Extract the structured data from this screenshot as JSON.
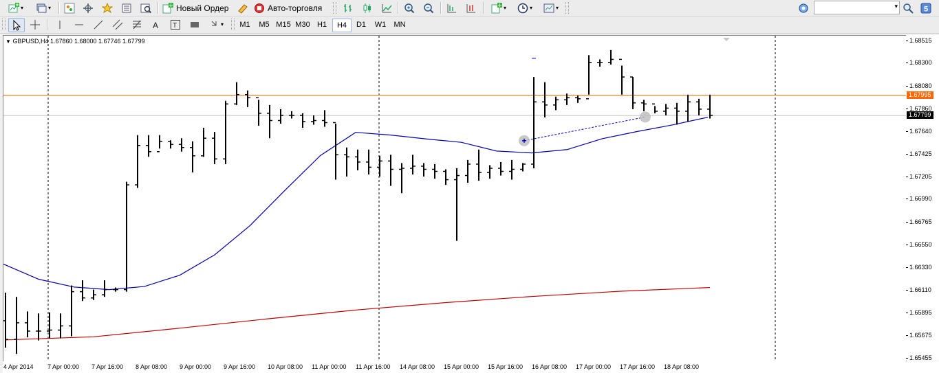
{
  "toolbar": {
    "new_order_label": "Новый Ордер",
    "autotrading_label": "Авто-торговля",
    "search_value": "",
    "icons": [
      "new-chart-icon",
      "profiles-icon",
      "market-watch-icon",
      "navigator-icon",
      "favorites-icon",
      "data-window-icon",
      "strategy-tester-icon",
      "new-order-icon",
      "autotrading-icon",
      "bar-chart-icon",
      "candlestick-icon",
      "line-chart-icon",
      "zoom-in-icon",
      "zoom-out-icon",
      "tile-icon",
      "autoscroll-icon",
      "indicators-icon",
      "periods-icon",
      "templates-icon",
      "options-icon",
      "search-icon",
      "help-icon"
    ]
  },
  "drawing_tools": [
    "cursor-icon",
    "crosshair-icon",
    "vertical-line-icon",
    "horizontal-line-icon",
    "trendline-icon",
    "equidistant-channel-icon",
    "fibonacci-icon",
    "text-icon",
    "text-label-icon",
    "rectangle-icon",
    "arrows-icon"
  ],
  "timeframes": [
    "M1",
    "M5",
    "M15",
    "M30",
    "H1",
    "H4",
    "D1",
    "W1",
    "MN"
  ],
  "active_timeframe": "H4",
  "chart": {
    "symbol_info": "GBPUSD,H4  1.67860 1.68000 1.67746 1.67799",
    "colors": {
      "bars": "#000000",
      "ma_fast": "#0000aa",
      "ma_slow": "#c00000",
      "price_line": "#ff6600",
      "bid_line": "#c0c0c0",
      "current_price_bg": "#000000",
      "marker_price_bg": "#ff6600"
    }
  },
  "chart_data": {
    "type": "ohlc",
    "symbol": "GBPUSD",
    "timeframe": "H4",
    "y_ticks": [
      "1.68515",
      "1.68300",
      "1.68080",
      "1.67860",
      "1.67640",
      "1.67425",
      "1.67205",
      "1.66990",
      "1.66765",
      "1.66550",
      "1.66330",
      "1.66110",
      "1.65895",
      "1.65675",
      "1.65455"
    ],
    "ylim": [
      1.65455,
      1.68515
    ],
    "x_labels": [
      "4 Apr 2014",
      "7 Apr 00:00",
      "7 Apr 16:00",
      "8 Apr 08:00",
      "9 Apr 00:00",
      "9 Apr 16:00",
      "10 Apr 08:00",
      "11 Apr 00:00",
      "11 Apr 16:00",
      "14 Apr 08:00",
      "15 Apr 00:00",
      "15 Apr 16:00",
      "16 Apr 08:00",
      "17 Apr 00:00",
      "17 Apr 16:00",
      "18 Apr 08:00"
    ],
    "current_price": "1.67799",
    "marked_price": "1.67995",
    "bars": [
      [
        1.6582,
        1.6609,
        1.6556,
        1.6564
      ],
      [
        1.6564,
        1.6605,
        1.655,
        1.658
      ],
      [
        1.658,
        1.6591,
        1.6566,
        1.6572
      ],
      [
        1.6572,
        1.6589,
        1.6563,
        1.6572
      ],
      [
        1.6572,
        1.659,
        1.6565,
        1.6573
      ],
      [
        1.6573,
        1.6589,
        1.6565,
        1.6577
      ],
      [
        1.6577,
        1.6616,
        1.6567,
        1.661
      ],
      [
        1.661,
        1.6621,
        1.6601,
        1.6604
      ],
      [
        1.6604,
        1.6612,
        1.6602,
        1.6607
      ],
      [
        1.6607,
        1.6621,
        1.6605,
        1.6612
      ],
      [
        1.6612,
        1.6614,
        1.661,
        1.6612
      ],
      [
        1.6612,
        1.6716,
        1.661,
        1.6713
      ],
      [
        1.6713,
        1.6761,
        1.671,
        1.6751
      ],
      [
        1.6751,
        1.6761,
        1.674,
        1.6745
      ],
      [
        1.6745,
        1.6761,
        1.6748,
        1.6755
      ],
      [
        1.6755,
        1.6756,
        1.6748,
        1.6752
      ],
      [
        1.6752,
        1.6758,
        1.6745,
        1.6749
      ],
      [
        1.6749,
        1.6755,
        1.6725,
        1.6741
      ],
      [
        1.6741,
        1.6768,
        1.674,
        1.6758
      ],
      [
        1.6758,
        1.6764,
        1.6733,
        1.6738
      ],
      [
        1.6738,
        1.6794,
        1.6733,
        1.6791
      ],
      [
        1.6791,
        1.6812,
        1.679,
        1.68
      ],
      [
        1.68,
        1.6804,
        1.6788,
        1.6797
      ],
      [
        1.6797,
        1.6795,
        1.677,
        1.6782
      ],
      [
        1.6782,
        1.679,
        1.6758,
        1.6775
      ],
      [
        1.6775,
        1.6786,
        1.6772,
        1.678
      ],
      [
        1.678,
        1.6784,
        1.6777,
        1.678
      ],
      [
        1.678,
        1.6782,
        1.6768,
        1.6774
      ],
      [
        1.6774,
        1.678,
        1.6771,
        1.6775
      ],
      [
        1.6775,
        1.6785,
        1.6769,
        1.6773
      ],
      [
        1.6773,
        1.6772,
        1.6718,
        1.6742
      ],
      [
        1.6742,
        1.6749,
        1.6721,
        1.674
      ],
      [
        1.674,
        1.6747,
        1.6727,
        1.6735
      ],
      [
        1.6735,
        1.6747,
        1.6723,
        1.673
      ],
      [
        1.673,
        1.6741,
        1.6721,
        1.6736
      ],
      [
        1.6736,
        1.6742,
        1.6712,
        1.6728
      ],
      [
        1.6728,
        1.6734,
        1.6705,
        1.6729
      ],
      [
        1.6729,
        1.6742,
        1.6723,
        1.6731
      ],
      [
        1.6731,
        1.6734,
        1.6721,
        1.6728
      ],
      [
        1.6728,
        1.6733,
        1.6719,
        1.6726
      ],
      [
        1.6726,
        1.6728,
        1.6713,
        1.6718
      ],
      [
        1.6718,
        1.6729,
        1.6659,
        1.6722
      ],
      [
        1.6722,
        1.6737,
        1.6715,
        1.6733
      ],
      [
        1.6733,
        1.6747,
        1.6717,
        1.6725
      ],
      [
        1.6725,
        1.6732,
        1.6719,
        1.6729
      ],
      [
        1.6729,
        1.6735,
        1.6722,
        1.6726
      ],
      [
        1.6726,
        1.6737,
        1.6718,
        1.6728
      ],
      [
        1.6728,
        1.6734,
        1.6726,
        1.6733
      ],
      [
        1.6733,
        1.6817,
        1.6729,
        1.6793
      ],
      [
        1.6793,
        1.6812,
        1.6778,
        1.679
      ],
      [
        1.679,
        1.6798,
        1.6785,
        1.6795
      ],
      [
        1.6795,
        1.6801,
        1.679,
        1.6797
      ],
      [
        1.6797,
        1.6799,
        1.6792,
        1.6796
      ],
      [
        1.6796,
        1.6838,
        1.68,
        1.6831
      ],
      [
        1.6831,
        1.6834,
        1.6827,
        1.6831
      ],
      [
        1.6831,
        1.6843,
        1.6829,
        1.6834
      ],
      [
        1.6834,
        1.6828,
        1.68,
        1.6817
      ],
      [
        1.6817,
        1.6817,
        1.6786,
        1.6792
      ],
      [
        1.6792,
        1.6795,
        1.6784,
        1.6791
      ],
      [
        1.6791,
        1.6789,
        1.6782,
        1.6784
      ],
      [
        1.6784,
        1.6791,
        1.678,
        1.6787
      ],
      [
        1.6787,
        1.6792,
        1.6771,
        1.6784
      ],
      [
        1.6784,
        1.68,
        1.6774,
        1.6793
      ],
      [
        1.6793,
        1.6796,
        1.678,
        1.6786
      ],
      [
        1.6786,
        1.68,
        1.6777,
        1.678
      ]
    ],
    "ma_fast": [
      1.66366,
      1.6622,
      1.66145,
      1.6612,
      1.6615,
      1.66258,
      1.66456,
      1.66737,
      1.6708,
      1.67413,
      1.67636,
      1.6761,
      1.67573,
      1.6754,
      1.67456,
      1.67438,
      1.6747,
      1.67575,
      1.67645,
      1.67708,
      1.67782
    ],
    "ma_slow": [
      1.65635,
      1.65665,
      1.6575,
      1.6584,
      1.65925,
      1.65995,
      1.66055,
      1.66105,
      1.6614
    ],
    "trendline": [
      [
        47,
        1.67556
      ],
      [
        58,
        1.67784
      ]
    ]
  }
}
